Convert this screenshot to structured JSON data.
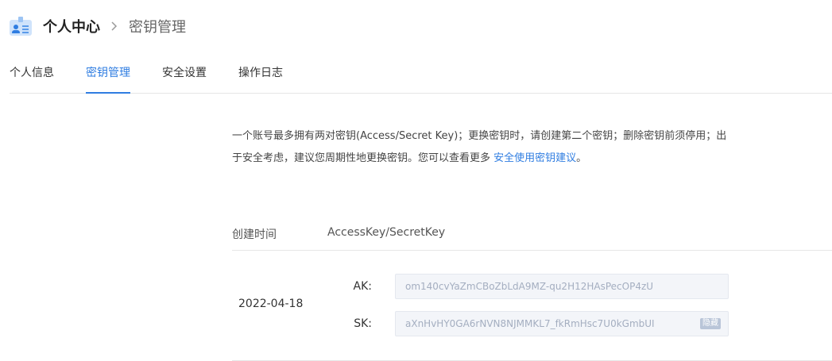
{
  "breadcrumb": {
    "root": "个人中心",
    "current": "密钥管理"
  },
  "tabs": [
    {
      "label": "个人信息",
      "active": false
    },
    {
      "label": "密钥管理",
      "active": true
    },
    {
      "label": "安全设置",
      "active": false
    },
    {
      "label": "操作日志",
      "active": false
    }
  ],
  "notice": {
    "text": "一个账号最多拥有两对密钥(Access/Secret Key)；更换密钥时，请创建第二个密钥；删除密钥前须停用；出于安全考虑，建议您周期性地更换密钥。您可以查看更多 ",
    "link": "安全使用密钥建议",
    "suffix": "。"
  },
  "table": {
    "headers": {
      "created_time": "创建时间",
      "key": "AccessKey/SecretKey"
    },
    "rows": [
      {
        "created_time": "2022-04-18",
        "ak_label": "AK:",
        "ak_value": "om140cvYaZmCBoZbLdA9MZ-qu2H12HAsPecOP4zU",
        "sk_label": "SK:",
        "sk_value": "aXnHvHY0GA6rNVN8NJMMKL7_fkRmHsc7U0kGmbUI",
        "hide_label": "隐藏"
      }
    ]
  },
  "colors": {
    "accent": "#2f7de1",
    "border": "#e6e6e6",
    "key_box_bg": "#f3f5f9",
    "key_text": "#a4aec0"
  },
  "icons": {
    "header": "profile-card-icon",
    "separator": "chevron-right-icon"
  }
}
